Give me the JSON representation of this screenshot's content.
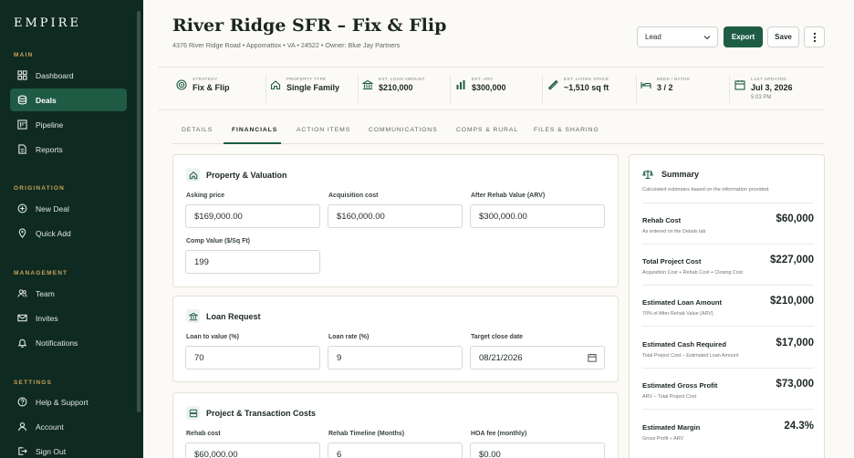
{
  "sidebar": {
    "brand": "EMPIRE",
    "sections": {
      "main": "MAIN",
      "origination": "ORIGINATION",
      "management": "MANAGEMENT",
      "settings": "SETTINGS"
    },
    "items": [
      {
        "label": "Dashboard",
        "icon": "dashboard-icon"
      },
      {
        "label": "Deals",
        "icon": "deals-icon",
        "active": true
      },
      {
        "label": "Pipeline",
        "icon": "pipeline-icon"
      },
      {
        "label": "Reports",
        "icon": "reports-icon"
      },
      {
        "label": "New Deal",
        "icon": "plus-circle-icon"
      },
      {
        "label": "Quick Add",
        "icon": "pin-icon"
      },
      {
        "label": "Team",
        "icon": "team-icon"
      },
      {
        "label": "Invites",
        "icon": "mail-icon"
      },
      {
        "label": "Notifications",
        "icon": "bell-icon"
      },
      {
        "label": "Help & Support",
        "icon": "help-icon"
      },
      {
        "label": "Account",
        "icon": "user-icon"
      },
      {
        "label": "Sign Out",
        "icon": "sign-out-icon"
      }
    ]
  },
  "header": {
    "title": "River Ridge SFR – Fix & Flip",
    "subtitle": "4376 River Ridge Road • Appomattox • VA • 24522 • Owner: Blue Jay Partners",
    "status_select": "Lead",
    "export_label": "Export",
    "save_label": "Save"
  },
  "stats": [
    {
      "label": "STRATEGY",
      "value": "Fix & Flip",
      "icon": "target-icon"
    },
    {
      "label": "PROPERTY TYPE",
      "value": "Single Family",
      "icon": "home-icon"
    },
    {
      "label": "EST. LOAN AMOUNT",
      "value": "$210,000",
      "icon": "bank-icon"
    },
    {
      "label": "EST. ARV",
      "value": "$300,000",
      "icon": "bar-chart-icon"
    },
    {
      "label": "EST. LIVING SPACE",
      "value": "~1,510 sq ft",
      "icon": "ruler-icon"
    },
    {
      "label": "BEDS / BATHS",
      "value": "3 / 2",
      "icon": "bed-icon"
    },
    {
      "label": "LAST UPDATED",
      "value": "Jul 3, 2026",
      "sub": "5:03 PM",
      "icon": "calendar-icon"
    }
  ],
  "tabs": [
    "DETAILS",
    "FINANCIALS",
    "ACTION ITEMS",
    "COMMUNICATIONS",
    "COMPS & RURAL",
    "FILES & SHARING"
  ],
  "property": {
    "title": "Property & Valuation",
    "asking_label": "Asking price",
    "asking_value": "$169,000.00",
    "acq_label": "Acquisition cost",
    "acq_value": "$160,000.00",
    "arv_label": "After Rehab Value (ARV)",
    "arv_value": "$300,000.00",
    "comp_label": "Comp Value ($/Sq Ft)",
    "comp_value": "199"
  },
  "loan": {
    "title": "Loan Request",
    "ltv_label": "Loan to value (%)",
    "ltv_value": "70",
    "rate_label": "Loan rate (%)",
    "rate_value": "9",
    "close_label": "Target close date",
    "close_value": "08/21/2026"
  },
  "costs": {
    "title": "Project & Transaction Costs",
    "rehab_label": "Rehab cost",
    "rehab_value": "$60,000.00",
    "timeline_label": "Rehab Timeline (Months)",
    "timeline_value": "6",
    "hoa_label": "HOA fee (monthly)",
    "hoa_value": "$0.00"
  },
  "summary": {
    "title": "Summary",
    "description": "Calculated estimates based on the information provided.",
    "rows": [
      {
        "label": "Rehab Cost",
        "desc": "As entered on the Details tab",
        "value": "$60,000"
      },
      {
        "label": "Total Project Cost",
        "desc": "Acquisition Cost + Rehab Cost + Closing Cost",
        "value": "$227,000"
      },
      {
        "label": "Estimated Loan Amount",
        "desc": "70% of After Rehab Value (ARV)",
        "value": "$210,000"
      },
      {
        "label": "Estimated Cash Required",
        "desc": "Total Project Cost – Estimated Loan Amount",
        "value": "$17,000"
      },
      {
        "label": "Estimated Gross Profit",
        "desc": "ARV – Total Project Cost",
        "value": "$73,000"
      },
      {
        "label": "Estimated Margin",
        "desc": "Gross Profit ÷ ARV",
        "value": "24.3%"
      }
    ]
  },
  "colors": {
    "sidebar_bg": "#0f2a21",
    "accent": "#1e5c46",
    "section_label": "#c9a35b",
    "page_bg": "#fcfaf6"
  }
}
